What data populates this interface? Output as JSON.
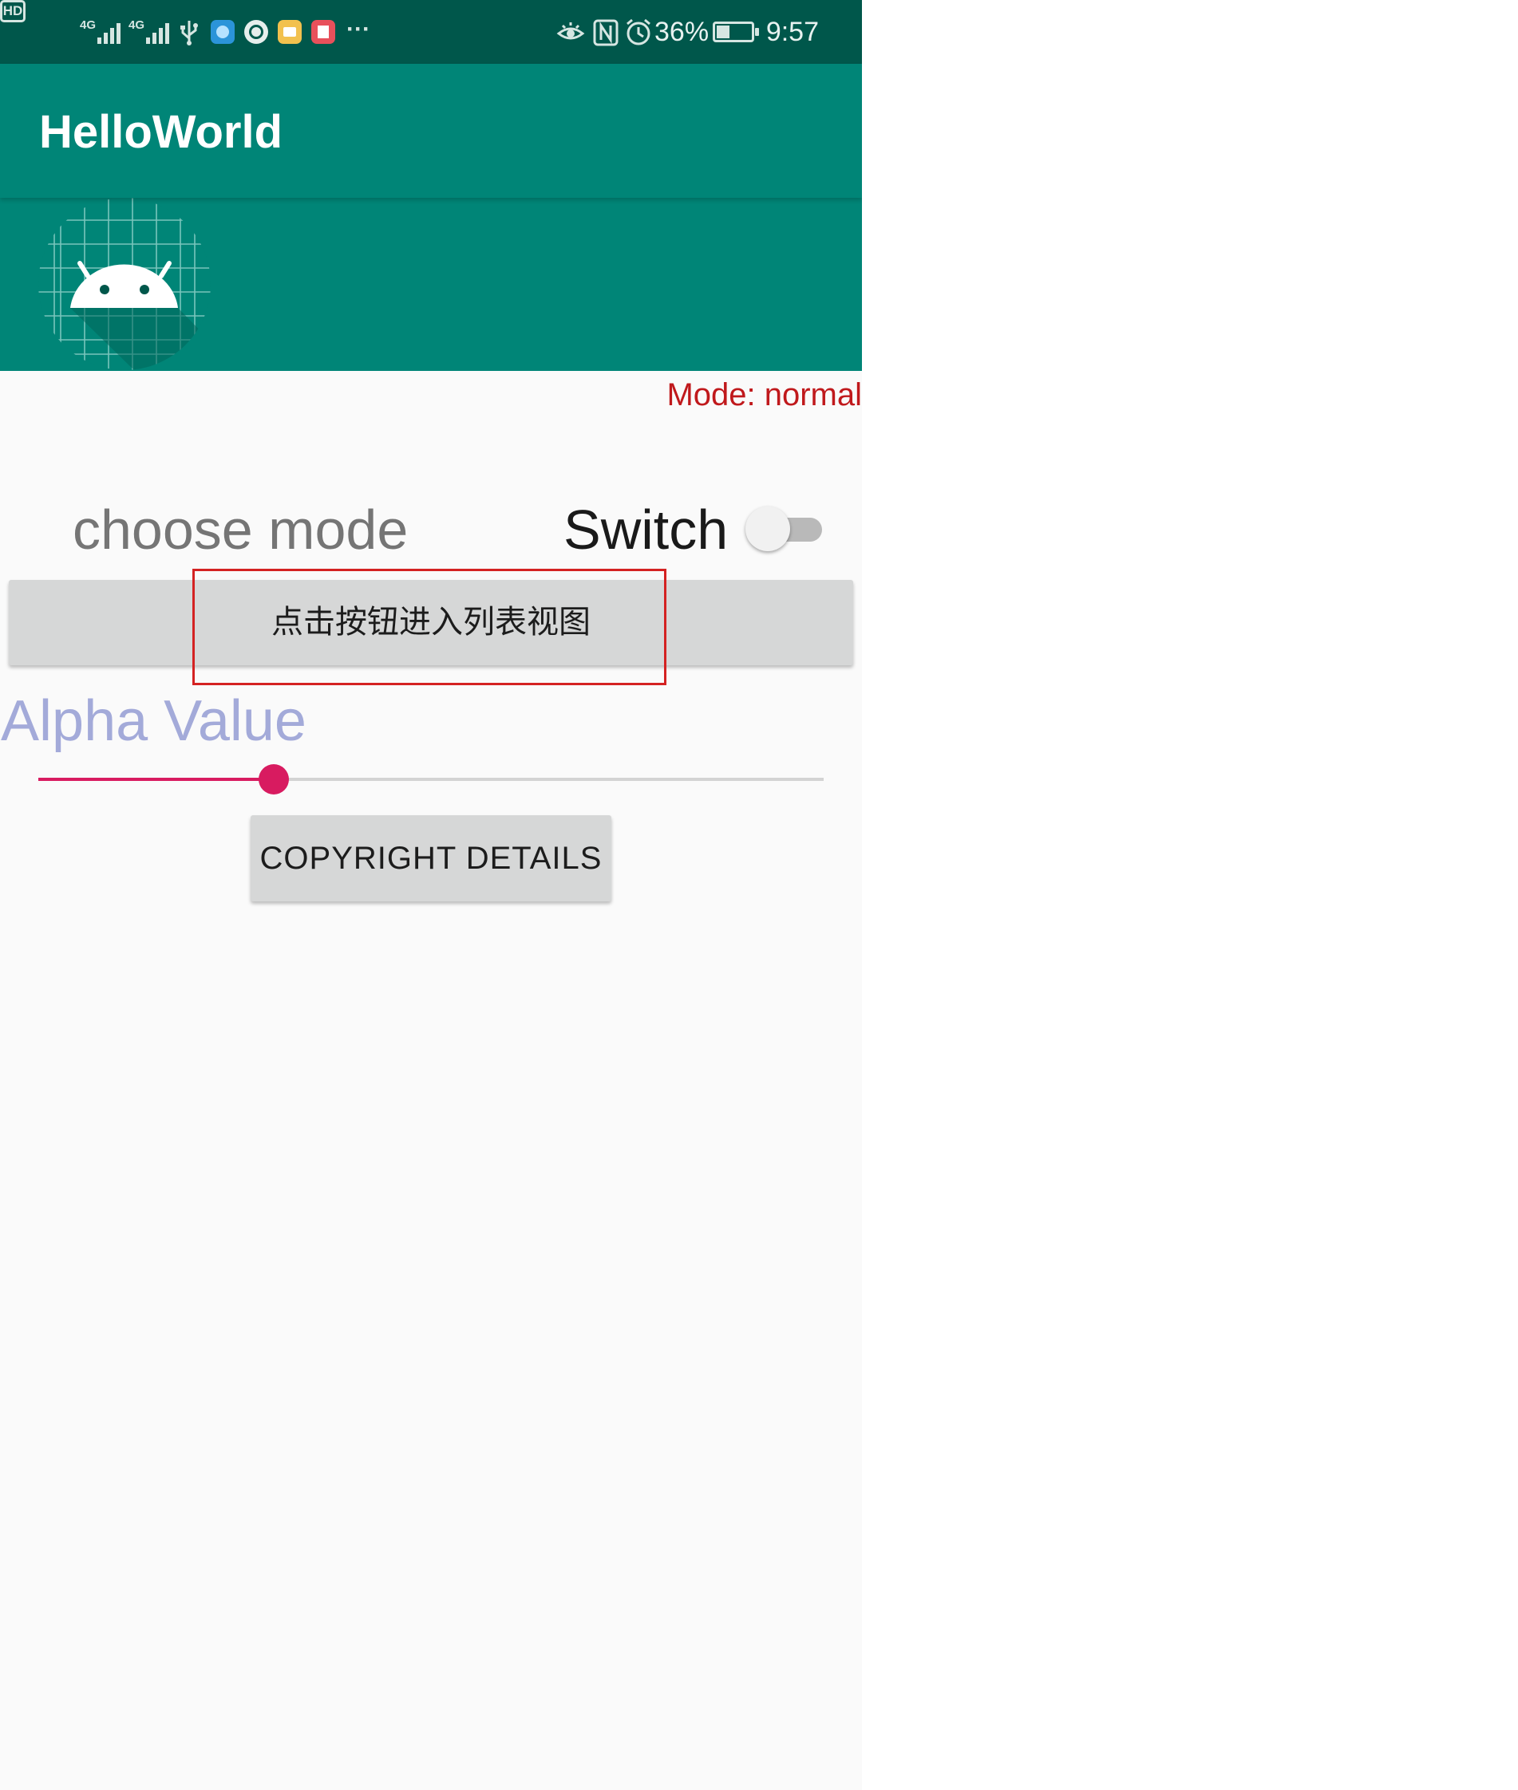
{
  "status_bar": {
    "hd_label": "HD",
    "signal_1_label": "4G",
    "signal_2_label": "4G",
    "more_indicator": "···",
    "battery_percent": "36%",
    "time": "9:57",
    "icons": [
      "hd-icon",
      "signal-icon",
      "signal-icon",
      "usb-icon",
      "app-notification-icon",
      "app-notification-icon",
      "app-notification-icon",
      "app-notification-icon",
      "more-icon",
      "eye-comfort-icon",
      "nfc-icon",
      "alarm-icon",
      "battery-charging-icon"
    ]
  },
  "app_bar": {
    "title": "HelloWorld"
  },
  "header": {
    "logo": "android-logo"
  },
  "mode": {
    "label": "Mode: normal"
  },
  "controls": {
    "choose_mode_label": "choose mode",
    "switch_label": "Switch",
    "switch_on": false,
    "list_button_label": "点击按钮进入列表视图",
    "alpha_label": "Alpha Value",
    "alpha_slider_fraction": 0.3,
    "copyright_button_label": "COPYRIGHT DETAILS"
  },
  "colors": {
    "status_bar": "#00574b",
    "primary": "#008577",
    "accent": "#d81b60",
    "mode_text": "#c0191c",
    "alpha_text": "#a3aad9",
    "highlight_box": "#d42222"
  }
}
